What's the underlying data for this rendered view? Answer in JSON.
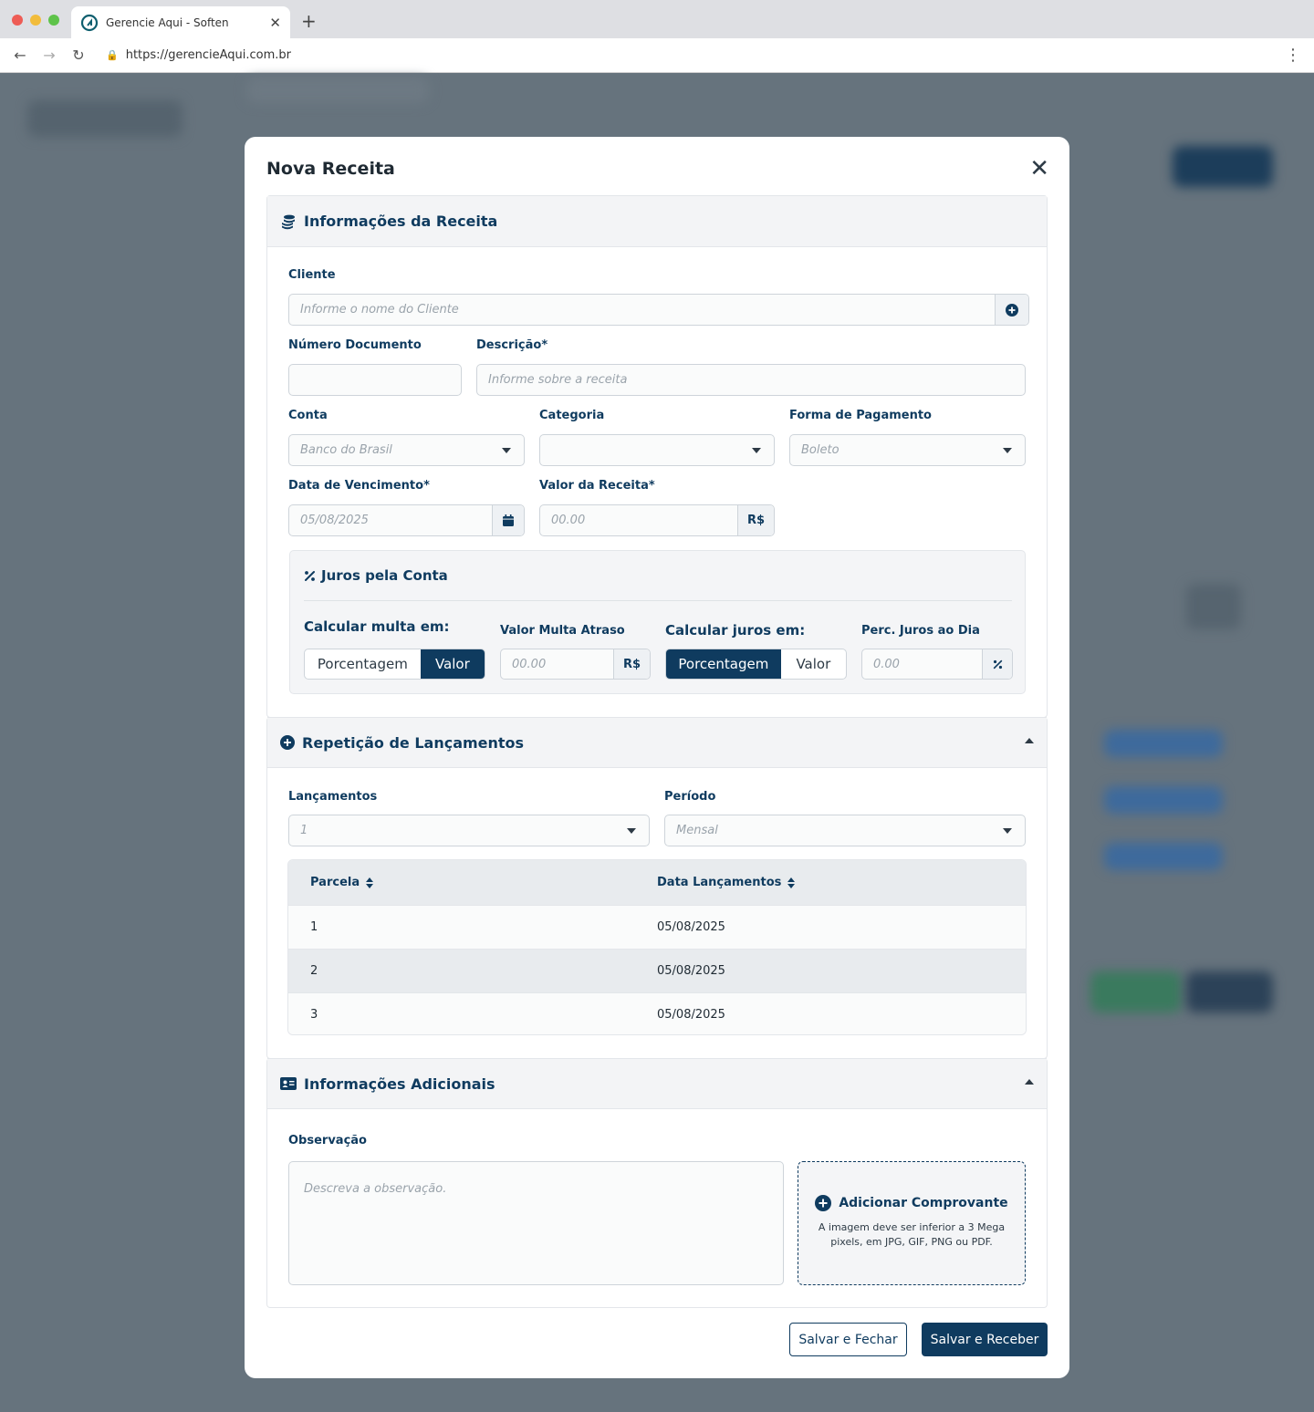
{
  "browser": {
    "tab_title": "Gerencie Aqui - Soften",
    "url": "https://gerencieAqui.com.br"
  },
  "modal": {
    "title": "Nova Receita",
    "info_section": {
      "title": "Informações da Receita",
      "cliente_label": "Cliente",
      "cliente_placeholder": "Informe o nome do Cliente",
      "numero_doc_label": "Número Documento",
      "numero_doc_value": "",
      "descricao_label": "Descrição*",
      "descricao_placeholder": "Informe sobre a receita",
      "conta_label": "Conta",
      "conta_value": "Banco do Brasil",
      "categoria_label": "Categoria",
      "categoria_value": "",
      "forma_pagamento_label": "Forma de Pagamento",
      "forma_pagamento_value": "Boleto",
      "data_venc_label": "Data de Vencimento*",
      "data_venc_value": "05/08/2025",
      "valor_label": "Valor da Receita*",
      "valor_placeholder": "00.00",
      "valor_addon": "R$"
    },
    "juros": {
      "title": "Juros pela Conta",
      "multa_label": "Calcular multa em:",
      "multa_options": [
        "Porcentagem",
        "Valor"
      ],
      "multa_selected": "Valor",
      "valor_multa_label": "Valor Multa Atraso",
      "valor_multa_placeholder": "00.00",
      "valor_multa_addon": "R$",
      "juros_label": "Calcular juros em:",
      "juros_options": [
        "Porcentagem",
        "Valor"
      ],
      "juros_selected": "Porcentagem",
      "perc_juros_label": "Perc. Juros ao Dia",
      "perc_juros_placeholder": "0.00"
    },
    "repeticao": {
      "title": "Repetição de Lançamentos",
      "lancamentos_label": "Lançamentos",
      "lancamentos_value": "1",
      "periodo_label": "Período",
      "periodo_value": "Mensal",
      "table": {
        "headers": [
          "Parcela",
          "Data Lançamentos"
        ],
        "rows": [
          [
            "1",
            "05/08/2025"
          ],
          [
            "2",
            "05/08/2025"
          ],
          [
            "3",
            "05/08/2025"
          ]
        ]
      }
    },
    "adicionais": {
      "title": "Informações Adicionais",
      "obs_label": "Observação",
      "obs_placeholder": "Descreva a observação.",
      "upload_title": "Adicionar Comprovante",
      "upload_desc": "A imagem deve ser inferior a 3 Mega pixels, em JPG, GIF, PNG ou PDF."
    },
    "buttons": {
      "save_close": "Salvar e Fechar",
      "save_receive": "Salvar e Receber"
    }
  },
  "colors": {
    "primary": "#0f3b5f",
    "backdrop": "#66737d"
  }
}
